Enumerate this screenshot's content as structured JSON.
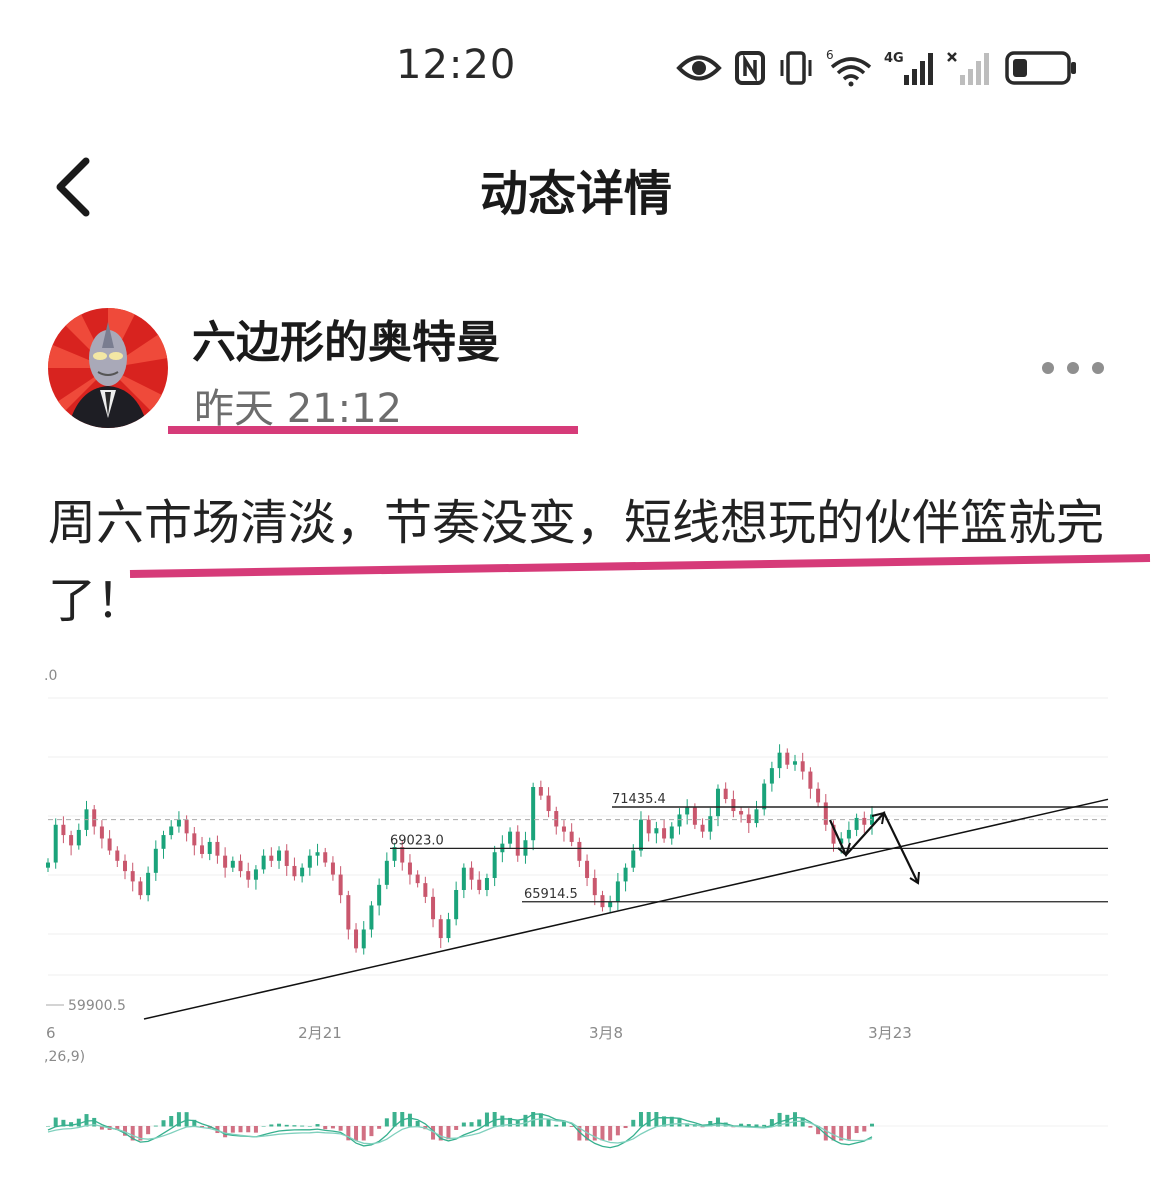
{
  "status_bar": {
    "time": "12:20",
    "icons": [
      "eye-icon",
      "nfc-icon",
      "vibrate-icon",
      "wifi-icon",
      "signal-4g-icon",
      "signal-nosim-icon",
      "battery-icon"
    ],
    "wifi_badge": "6",
    "signal_badge": "4G"
  },
  "nav": {
    "title": "动态详情",
    "back_icon": "back-arrow-icon"
  },
  "post": {
    "author": "六边形的奥特曼",
    "time": "昨天 21:12",
    "text_line1": "周六市场清淡，节奏没变，短线想玩的伙伴篮就完",
    "text_line2": "了！",
    "more_icon": "more-dots-icon"
  },
  "highlight_color": "#d63b79",
  "chart_data": {
    "type": "candlestick",
    "y_top_partial_label": ".0",
    "x_tick_labels": [
      {
        "label": "6",
        "x": "left edge"
      },
      {
        "label": "2月21",
        "x": "2月21"
      },
      {
        "label": "3月8",
        "x": "3月8"
      },
      {
        "label": "3月23",
        "x": "3月23"
      }
    ],
    "price_levels": [
      {
        "label": "71435.4",
        "value": 71435.4
      },
      {
        "label": "69023.0",
        "value": 69023.0
      },
      {
        "label": "65914.5",
        "value": 65914.5
      },
      {
        "label": "59900.5",
        "value": 59900.5
      }
    ],
    "current_price_dashed": 70700,
    "trendline_from": 59900,
    "trendline_to": 71650,
    "up_color": "#1aa37a",
    "down_color": "#c9576d",
    "candles_close": [
      68200,
      70400,
      69800,
      69200,
      70100,
      71300,
      70300,
      69600,
      68900,
      68300,
      67700,
      67100,
      66300,
      67600,
      69000,
      69800,
      70300,
      70700,
      69900,
      69200,
      68700,
      69400,
      68600,
      67900,
      68300,
      67700,
      67200,
      67800,
      68600,
      68300,
      68900,
      68000,
      67400,
      67900,
      68600,
      68800,
      68200,
      67500,
      66300,
      64300,
      63200,
      64300,
      65700,
      66900,
      68300,
      69100,
      68200,
      67500,
      67000,
      66200,
      64900,
      63800,
      64900,
      66600,
      67900,
      67200,
      66600,
      67300,
      68800,
      69300,
      70000,
      68600,
      69500,
      72600,
      72100,
      71200,
      70300,
      70000,
      69400,
      68300,
      67300,
      66300,
      65600,
      65900,
      67100,
      67900,
      68900,
      70700,
      69900,
      70200,
      69600,
      70300,
      71000,
      71400,
      70400,
      70000,
      70900,
      72500,
      71900,
      71200,
      71000,
      70500,
      71300,
      72800,
      73700,
      74600,
      73900,
      74100,
      73500,
      72500,
      71700,
      70400,
      69300,
      69600,
      70100,
      70800,
      70400,
      71000
    ],
    "indicator_label": ",26,9)"
  }
}
